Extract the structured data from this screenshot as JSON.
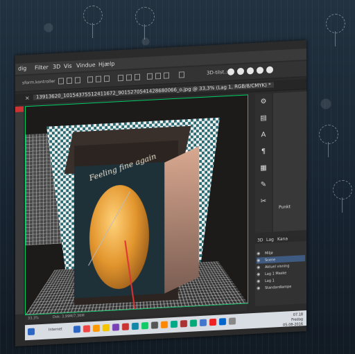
{
  "menu": {
    "items": [
      "dig",
      "Filter",
      "3D",
      "Vis",
      "Vindue",
      "Hjælp"
    ]
  },
  "options": {
    "label": "sform.kontroller",
    "mode_label": "3D-tilst.:"
  },
  "document": {
    "close": "×",
    "tab_title": "13913620_10154375512411672_9015270541428680066_o.jpg @ 33,3% (Lag 1, RGB/8/CMYK) *"
  },
  "canvas": {
    "caption": "Feeling fine again"
  },
  "status": {
    "zoom": "33,3%",
    "info": "Dok: 3,99M/7,36M"
  },
  "properties": {
    "point_label": "Punkt"
  },
  "layers": {
    "tabs": [
      "3D",
      "Lag",
      "Kana"
    ],
    "rows": [
      {
        "label": "Miljø",
        "selected": false
      },
      {
        "label": "Scene",
        "selected": true
      },
      {
        "label": "Aktuel visning",
        "selected": false
      },
      {
        "label": "Lag 1 Maske",
        "selected": false
      },
      {
        "label": "Lag 1",
        "selected": false
      },
      {
        "label": "Standardlampe",
        "selected": false
      }
    ]
  },
  "taskbar": {
    "search_text": "Internet",
    "time": "07.18",
    "day": "Fredag",
    "date": "05-08-2016",
    "icon_colors": [
      "#2b66c4",
      "#e44",
      "#f90",
      "#f5c400",
      "#7a3fb5",
      "#c33",
      "#18a",
      "#1c6",
      "#555",
      "#f80",
      "#0a8",
      "#a33",
      "#0a7",
      "#47c",
      "#e22",
      "#06c",
      "#888"
    ]
  }
}
